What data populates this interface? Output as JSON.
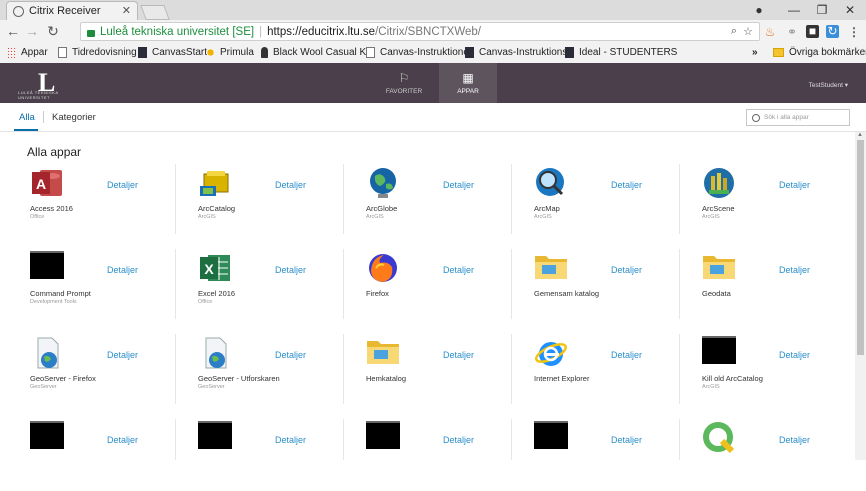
{
  "browser": {
    "tab_title": "Citrix Receiver",
    "address": {
      "secure_label": "Luleå tekniska universitet [SE]",
      "url_host": "https://educitrix.ltu.se",
      "url_path": "/Citrix/SBNCTXWeb/"
    },
    "bookmarks": [
      "Appar",
      "Tidredovisning",
      "CanvasStart",
      "Primula",
      "Black Wool Casual K",
      "Canvas-Instruktioner",
      "Canvas-Instruktionsf",
      "Ideal - STUDENTERS"
    ],
    "bookmarks_overflow": "»",
    "other_bookmarks": "Övriga bokmärken"
  },
  "header": {
    "logo_letter": "L",
    "logo_text": "LULEÅ TEKNISKA UNIVERSITET",
    "tabs": [
      {
        "label": "FAVORITER",
        "icon": "bookmark-icon"
      },
      {
        "label": "APPAR",
        "icon": "grid-icon"
      }
    ],
    "user": "TestStudent"
  },
  "subnav": {
    "tabs": [
      "Alla",
      "Kategorier"
    ],
    "search_placeholder": "Sök i alla appar"
  },
  "main": {
    "title": "Alla appar",
    "detail_label": "Detaljer",
    "apps": [
      {
        "name": "Access 2016",
        "category": "Office",
        "icon": "access-icon"
      },
      {
        "name": "ArcCatalog",
        "category": "ArcGIS",
        "icon": "arccatalog-icon"
      },
      {
        "name": "ArcGlobe",
        "category": "ArcGIS",
        "icon": "arcglobe-icon"
      },
      {
        "name": "ArcMap",
        "category": "ArcGIS",
        "icon": "arcmap-icon"
      },
      {
        "name": "ArcScene",
        "category": "ArcGIS",
        "icon": "arcscene-icon"
      },
      {
        "name": "Command Prompt",
        "category": "Development Tools",
        "icon": "terminal-icon"
      },
      {
        "name": "Excel 2016",
        "category": "Office",
        "icon": "excel-icon"
      },
      {
        "name": "Firefox",
        "category": "",
        "icon": "firefox-icon"
      },
      {
        "name": "Gemensam katalog",
        "category": "",
        "icon": "folder-icon"
      },
      {
        "name": "Geodata",
        "category": "",
        "icon": "folder-icon"
      },
      {
        "name": "GeoServer - Firefox",
        "category": "GeoServer",
        "icon": "geoserver-icon"
      },
      {
        "name": "GeoServer - Utforskaren",
        "category": "GeoServer",
        "icon": "geoserver-icon"
      },
      {
        "name": "Hemkatalog",
        "category": "",
        "icon": "folder-icon"
      },
      {
        "name": "Internet Explorer",
        "category": "",
        "icon": "ie-icon"
      },
      {
        "name": "Kill old ArcCatalog",
        "category": "ArcGIS",
        "icon": "terminal-icon"
      },
      {
        "name": "",
        "category": "",
        "icon": "terminal-icon"
      },
      {
        "name": "",
        "category": "",
        "icon": "terminal-icon"
      },
      {
        "name": "",
        "category": "",
        "icon": "terminal-icon"
      },
      {
        "name": "",
        "category": "",
        "icon": "terminal-icon"
      },
      {
        "name": "",
        "category": "",
        "icon": "qgis-icon"
      }
    ]
  }
}
